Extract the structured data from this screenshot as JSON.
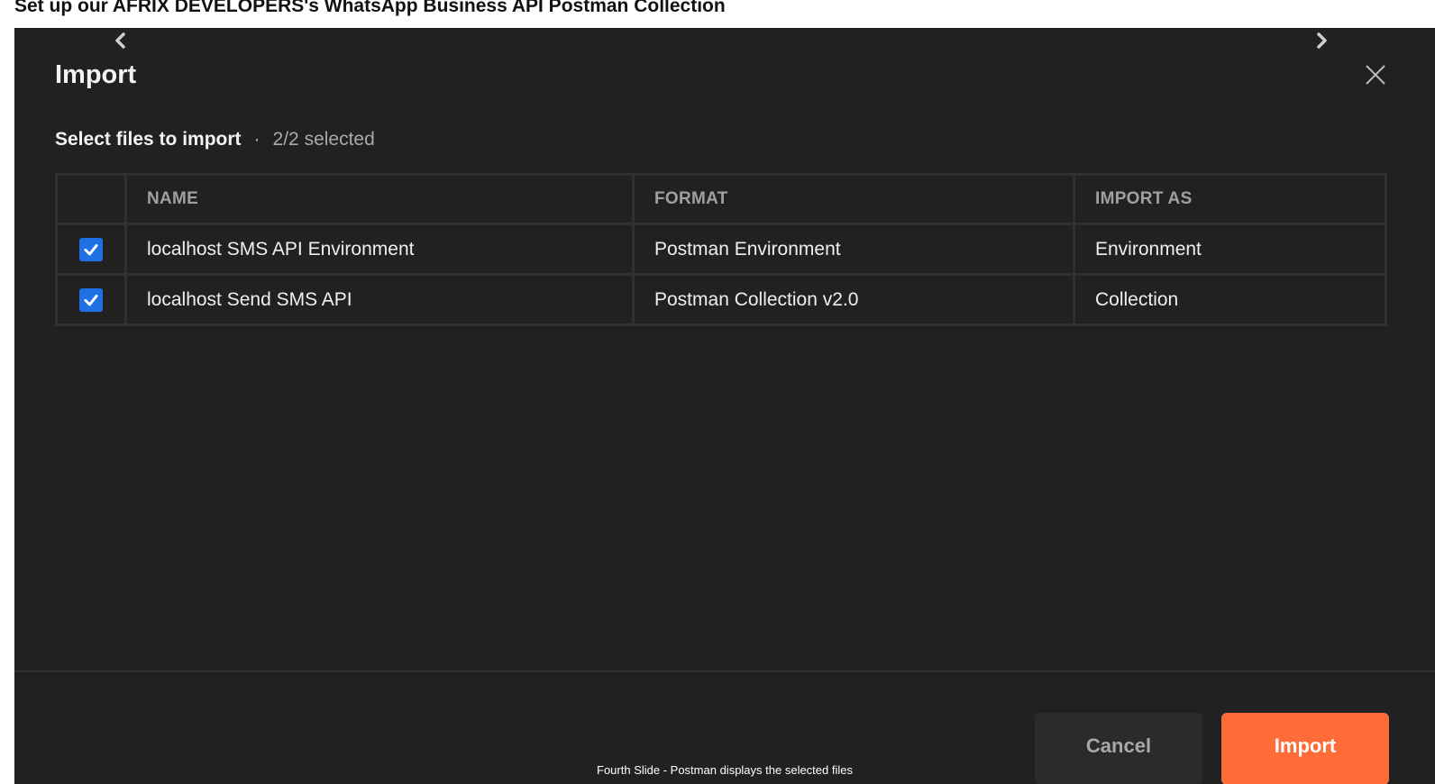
{
  "page": {
    "heading": "Set up our AFRIX DEVELOPERS's WhatsApp Business API Postman Collection"
  },
  "carousel": {
    "prev_icon": "chevron-left-icon",
    "next_icon": "chevron-right-icon",
    "caption": "Fourth Slide - Postman displays the selected files"
  },
  "dialog": {
    "title": "Import",
    "close_icon": "close-icon",
    "select_label": "Select files to import",
    "separator": "·",
    "selected_count": "2/2 selected",
    "columns": [
      "NAME",
      "FORMAT",
      "IMPORT AS"
    ],
    "rows": [
      {
        "checked": true,
        "name": "localhost SMS API Environment",
        "format": "Postman Environment",
        "import_as": "Environment"
      },
      {
        "checked": true,
        "name": "localhost Send SMS API",
        "format": "Postman Collection v2.0",
        "import_as": "Collection"
      }
    ],
    "cancel_label": "Cancel",
    "import_label": "Import"
  },
  "colors": {
    "dialog_background": "#212121",
    "accent_orange": "#ff6c37",
    "checkbox_blue": "#1f6fe5"
  }
}
